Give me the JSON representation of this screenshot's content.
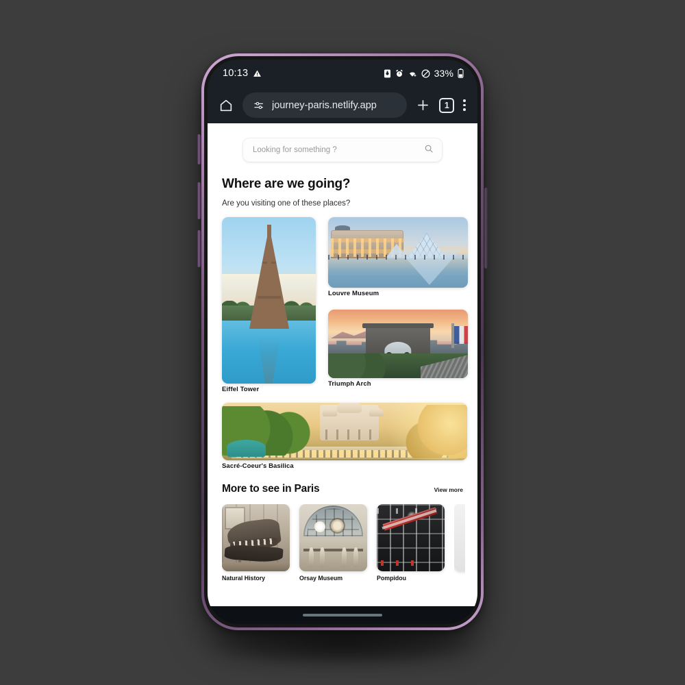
{
  "status_bar": {
    "time": "10:13",
    "battery_percent": "33%",
    "icons": [
      "warning-triangle-icon",
      "sim-icon",
      "alarm-icon",
      "wifi-icon",
      "do-not-disturb-icon",
      "battery-icon"
    ]
  },
  "browser": {
    "home_icon": "home-icon",
    "site_settings_icon": "tune-sliders-icon",
    "url": "journey-paris.netlify.app",
    "new_tab_icon": "plus-icon",
    "tab_count": "1",
    "menu_icon": "kebab-menu-icon"
  },
  "search": {
    "placeholder": "Looking for something ?",
    "value": "",
    "icon": "search-icon"
  },
  "hero": {
    "title": "Where are we going?",
    "subtitle": "Are you visiting one of these places?"
  },
  "destinations": [
    {
      "name": "Eiffel Tower"
    },
    {
      "name": "Louvre Museum"
    },
    {
      "name": "Triumph Arch"
    },
    {
      "name": "Sacré-Coeur's Basilica"
    }
  ],
  "more_section": {
    "title": "More to see in Paris",
    "view_more_label": "View more",
    "items": [
      {
        "name": "Natural History"
      },
      {
        "name": "Orsay Museum"
      },
      {
        "name": "Pompidou"
      }
    ]
  },
  "colors": {
    "page_background": "#3d3d3d",
    "chrome_background": "#1b2026",
    "omnibox_background": "#2a3138",
    "page_white": "#ffffff",
    "text_primary": "#111111",
    "placeholder": "#9a9a9a",
    "phone_frame": "#a77fae"
  }
}
